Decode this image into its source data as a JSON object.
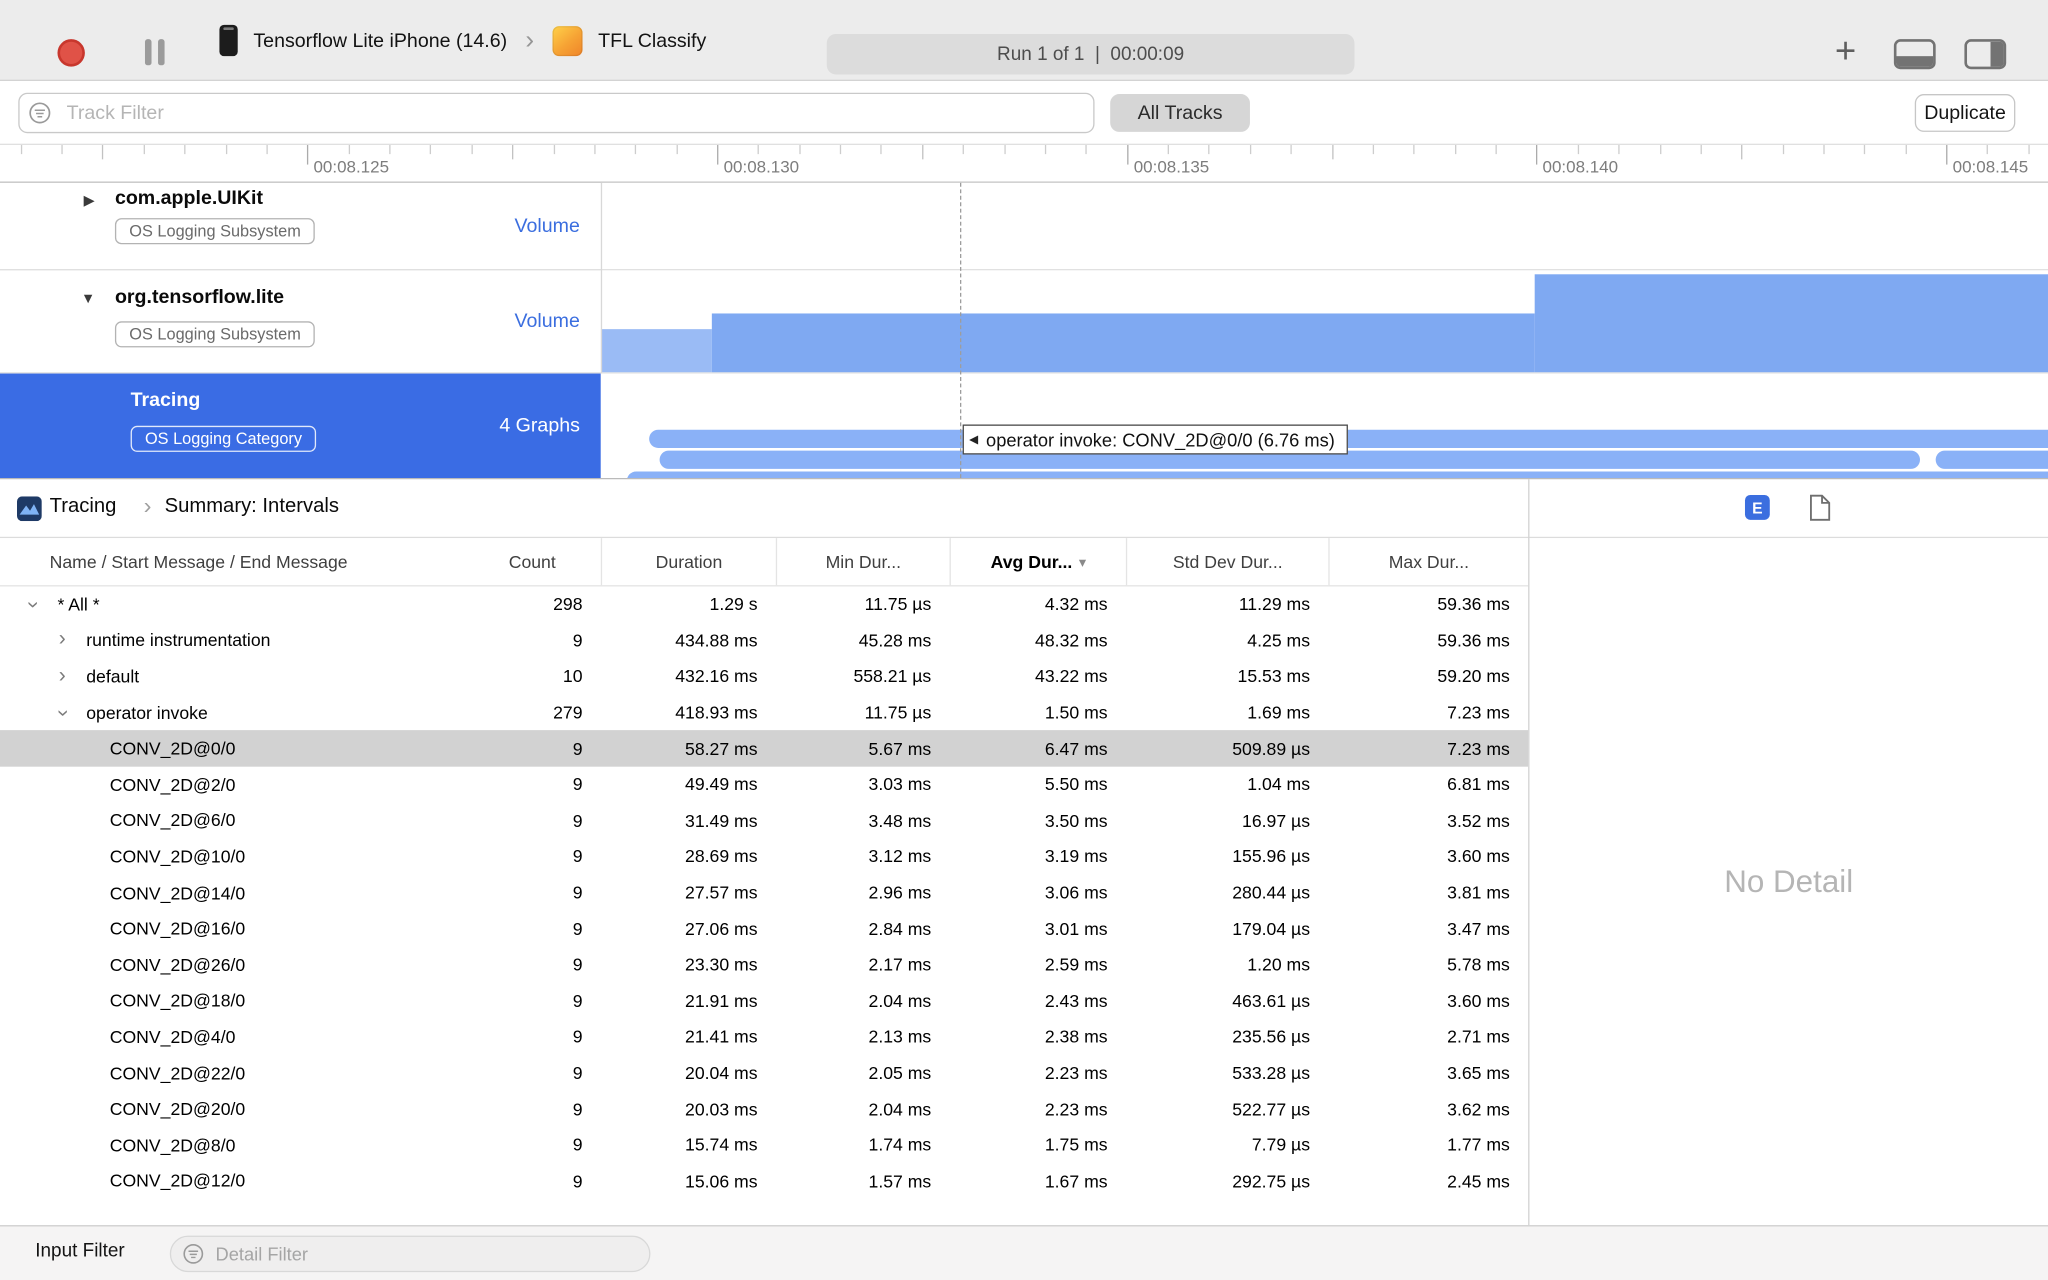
{
  "colors": {
    "accent-blue": "#3b6edf",
    "selection-blue": "#3a6ce4",
    "chart-blue": "#7fa9f2",
    "chart-blue-light": "#9abbf5",
    "pill-blue": "#8ab1f7",
    "selected-row": "#d2d2d2",
    "record-red": "#e05247"
  },
  "icons": {
    "plus": "+",
    "chevron": "›",
    "triangle-right": "▶",
    "triangle-down": "▼",
    "triangle-left": "◀",
    "sort-down": "▾"
  },
  "toolbar": {
    "device_name": "Tensorflow Lite iPhone (14.6)",
    "app_name": "TFL Classify",
    "run_info": "Run 1 of 1  |  00:00:09"
  },
  "filter_bar": {
    "track_filter_placeholder": "Track Filter",
    "all_tracks_label": "All Tracks",
    "duplicate_label": "Duplicate"
  },
  "ruler": {
    "labels": [
      "00:08.125",
      "00:08.130",
      "00:08.135",
      "00:08.140",
      "00:08.145"
    ]
  },
  "tracks": [
    {
      "name": "com.apple.UIKit",
      "badge": "OS Logging Subsystem",
      "meta": "Volume",
      "selected": false
    },
    {
      "name": "org.tensorflow.lite",
      "badge": "OS Logging Subsystem",
      "meta": "Volume",
      "selected": false
    },
    {
      "name": "Tracing",
      "badge": "OS Logging Category",
      "meta": "4 Graphs",
      "selected": true
    }
  ],
  "timeline": {
    "tooltip": "operator invoke: CONV_2D@0/0 (6.76 ms)"
  },
  "detail_header": {
    "breadcrumb_root": "Tracing",
    "breadcrumb_page": "Summary: Intervals",
    "extended_detail_badge": "E"
  },
  "table": {
    "columns": [
      "Name / Start Message / End Message",
      "Count",
      "Duration",
      "Min Dur...",
      "Avg Dur...",
      "Std Dev Dur...",
      "Max Dur..."
    ],
    "rows": [
      {
        "indent": 0,
        "disclosure": "down",
        "name": "* All *",
        "count": "298",
        "duration": "1.29 s",
        "min": "11.75 µs",
        "avg": "4.32 ms",
        "std": "11.29 ms",
        "max": "59.36 ms"
      },
      {
        "indent": 1,
        "disclosure": "right",
        "name": "runtime instrumentation",
        "count": "9",
        "duration": "434.88 ms",
        "min": "45.28 ms",
        "avg": "48.32 ms",
        "std": "4.25 ms",
        "max": "59.36 ms"
      },
      {
        "indent": 1,
        "disclosure": "right",
        "name": "default",
        "count": "10",
        "duration": "432.16 ms",
        "min": "558.21 µs",
        "avg": "43.22 ms",
        "std": "15.53 ms",
        "max": "59.20 ms"
      },
      {
        "indent": 1,
        "disclosure": "down",
        "name": "operator invoke",
        "count": "279",
        "duration": "418.93 ms",
        "min": "11.75 µs",
        "avg": "1.50 ms",
        "std": "1.69 ms",
        "max": "7.23 ms"
      },
      {
        "indent": 2,
        "disclosure": null,
        "name": "CONV_2D@0/0",
        "count": "9",
        "duration": "58.27 ms",
        "min": "5.67 ms",
        "avg": "6.47 ms",
        "std": "509.89 µs",
        "max": "7.23 ms",
        "selected": true
      },
      {
        "indent": 2,
        "disclosure": null,
        "name": "CONV_2D@2/0",
        "count": "9",
        "duration": "49.49 ms",
        "min": "3.03 ms",
        "avg": "5.50 ms",
        "std": "1.04 ms",
        "max": "6.81 ms"
      },
      {
        "indent": 2,
        "disclosure": null,
        "name": "CONV_2D@6/0",
        "count": "9",
        "duration": "31.49 ms",
        "min": "3.48 ms",
        "avg": "3.50 ms",
        "std": "16.97 µs",
        "max": "3.52 ms"
      },
      {
        "indent": 2,
        "disclosure": null,
        "name": "CONV_2D@10/0",
        "count": "9",
        "duration": "28.69 ms",
        "min": "3.12 ms",
        "avg": "3.19 ms",
        "std": "155.96 µs",
        "max": "3.60 ms"
      },
      {
        "indent": 2,
        "disclosure": null,
        "name": "CONV_2D@14/0",
        "count": "9",
        "duration": "27.57 ms",
        "min": "2.96 ms",
        "avg": "3.06 ms",
        "std": "280.44 µs",
        "max": "3.81 ms"
      },
      {
        "indent": 2,
        "disclosure": null,
        "name": "CONV_2D@16/0",
        "count": "9",
        "duration": "27.06 ms",
        "min": "2.84 ms",
        "avg": "3.01 ms",
        "std": "179.04 µs",
        "max": "3.47 ms"
      },
      {
        "indent": 2,
        "disclosure": null,
        "name": "CONV_2D@26/0",
        "count": "9",
        "duration": "23.30 ms",
        "min": "2.17 ms",
        "avg": "2.59 ms",
        "std": "1.20 ms",
        "max": "5.78 ms"
      },
      {
        "indent": 2,
        "disclosure": null,
        "name": "CONV_2D@18/0",
        "count": "9",
        "duration": "21.91 ms",
        "min": "2.04 ms",
        "avg": "2.43 ms",
        "std": "463.61 µs",
        "max": "3.60 ms"
      },
      {
        "indent": 2,
        "disclosure": null,
        "name": "CONV_2D@4/0",
        "count": "9",
        "duration": "21.41 ms",
        "min": "2.13 ms",
        "avg": "2.38 ms",
        "std": "235.56 µs",
        "max": "2.71 ms"
      },
      {
        "indent": 2,
        "disclosure": null,
        "name": "CONV_2D@22/0",
        "count": "9",
        "duration": "20.04 ms",
        "min": "2.05 ms",
        "avg": "2.23 ms",
        "std": "533.28 µs",
        "max": "3.65 ms"
      },
      {
        "indent": 2,
        "disclosure": null,
        "name": "CONV_2D@20/0",
        "count": "9",
        "duration": "20.03 ms",
        "min": "2.04 ms",
        "avg": "2.23 ms",
        "std": "522.77 µs",
        "max": "3.62 ms"
      },
      {
        "indent": 2,
        "disclosure": null,
        "name": "CONV_2D@8/0",
        "count": "9",
        "duration": "15.74 ms",
        "min": "1.74 ms",
        "avg": "1.75 ms",
        "std": "7.79 µs",
        "max": "1.77 ms"
      },
      {
        "indent": 2,
        "disclosure": null,
        "name": "CONV_2D@12/0",
        "count": "9",
        "duration": "15.06 ms",
        "min": "1.57 ms",
        "avg": "1.67 ms",
        "std": "292.75 µs",
        "max": "2.45 ms"
      }
    ]
  },
  "detail_panel": {
    "empty_text": "No Detail"
  },
  "bottom_bar": {
    "label": "Input Filter",
    "detail_filter_placeholder": "Detail Filter"
  }
}
